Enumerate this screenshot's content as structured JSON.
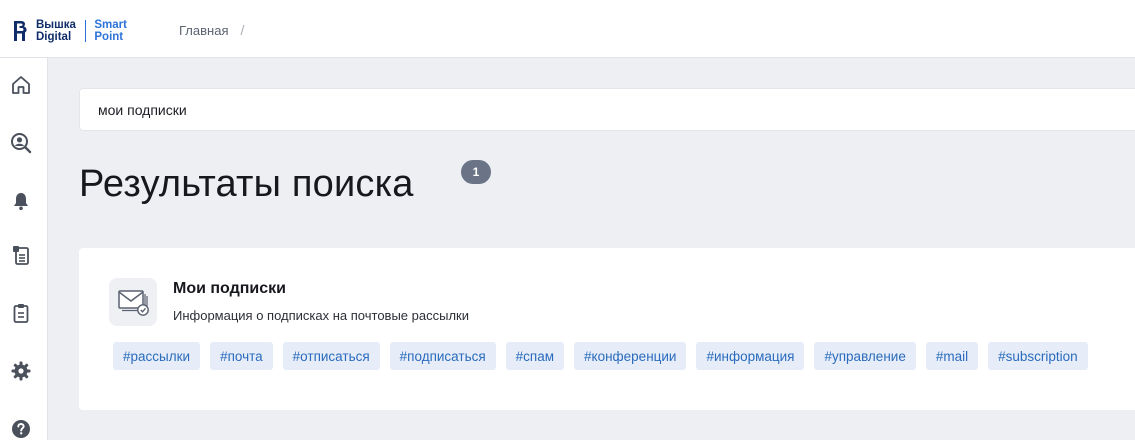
{
  "header": {
    "logo": {
      "line1a": "Вышка",
      "line1b": "Digital",
      "line2a": "Smart",
      "line2b": "Point"
    },
    "breadcrumb": {
      "home_label": "Главная",
      "separator": "/"
    }
  },
  "sidebar": {
    "items": [
      {
        "icon": "home-icon"
      },
      {
        "icon": "search-person-icon"
      },
      {
        "icon": "bell-icon"
      },
      {
        "icon": "document-list-icon"
      },
      {
        "icon": "clipboard-icon"
      },
      {
        "icon": "gear-icon"
      },
      {
        "icon": "help-icon"
      }
    ]
  },
  "search": {
    "value": "мои подписки"
  },
  "results": {
    "title": "Результаты поиска",
    "count": "1",
    "items": [
      {
        "icon": "mail-icon",
        "title": "Мои подписки",
        "description": "Информация о подписках на почтовые рассылки",
        "tags": [
          "#рассылки",
          "#почта",
          "#отписаться",
          "#подписаться",
          "#спам",
          "#конференции",
          "#информация",
          "#управление",
          "#mail",
          "#subscription"
        ]
      }
    ]
  },
  "colors": {
    "accent": "#2c73d9",
    "brand_dark": "#102d69",
    "tag_bg": "#e6edf8",
    "tag_text": "#2a6bbd",
    "badge_bg": "#6a7486",
    "page_bg": "#eeeff3"
  }
}
